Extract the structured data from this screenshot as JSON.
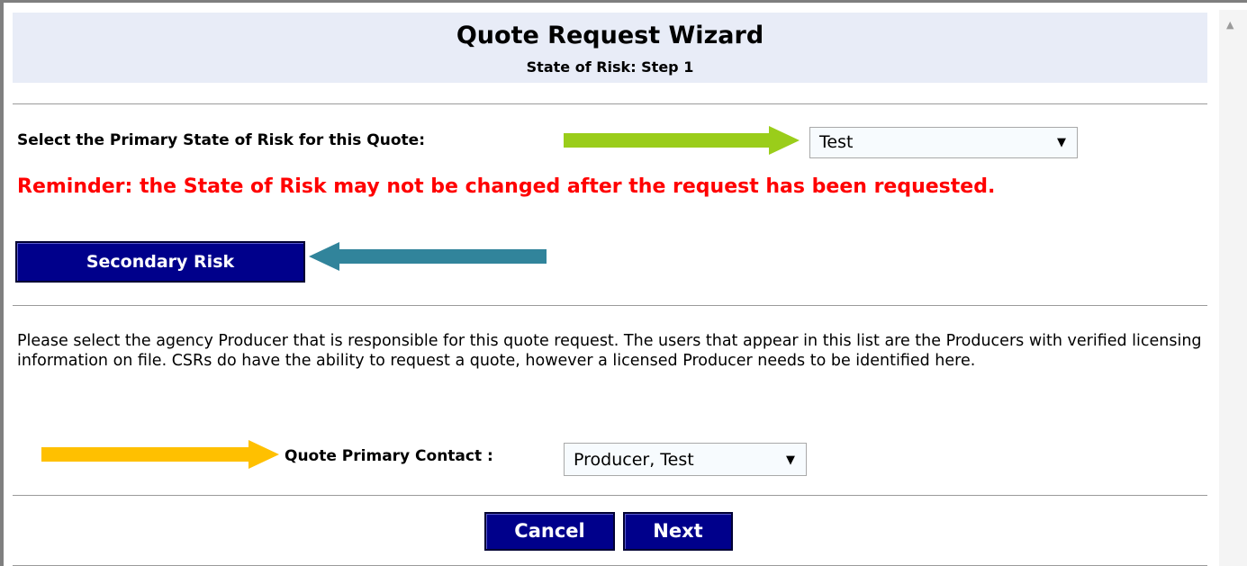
{
  "wizard": {
    "title": "Quote Request Wizard",
    "subtitle": "State of Risk: Step 1"
  },
  "state_of_risk": {
    "label": "Select the Primary State of Risk for this Quote:",
    "selected": "Test",
    "reminder": "Reminder: the State of Risk may not be changed after the request has been requested."
  },
  "secondary_risk": {
    "label": "Secondary Risk"
  },
  "producer": {
    "description": "Please select the agency Producer that is responsible for this quote request. The users that appear in this list are the Producers with verified licensing information on file. CSRs do have the ability to request a quote, however a licensed Producer needs to be identified here.",
    "contact_label": "Quote Primary Contact :",
    "contact_selected": "Producer, Test"
  },
  "actions": {
    "cancel": "Cancel",
    "next": "Next"
  },
  "icons": {
    "dropdown": "chevron-down-icon",
    "scroll_up": "scroll-up-arrow-icon",
    "annotation_arrows": [
      "arrow-right-icon",
      "arrow-left-icon",
      "arrow-right-icon"
    ]
  },
  "colors": {
    "header_bg": "#e8ecf7",
    "button_bg": "#00008b",
    "reminder": "#ff0000",
    "arrow_green": "#9acd1a",
    "arrow_teal": "#31849b",
    "arrow_gold": "#ffc000"
  }
}
